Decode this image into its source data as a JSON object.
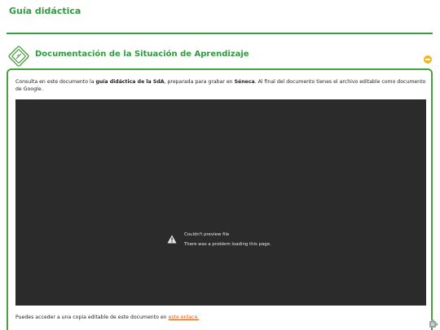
{
  "page": {
    "title": "Guía didáctica"
  },
  "section": {
    "title": "Documentación de la Situación de Aprendizaje"
  },
  "card": {
    "intro": {
      "t1": "Consulta en este documento la ",
      "b1": "guía didáctica de la SdA",
      "t2": ", preparada para grabar en ",
      "b2": "Séneca",
      "t3": ". Al final del documento tienes el archivo editable como documento de Google."
    },
    "preview": {
      "error_title": "Couldn't preview file",
      "error_message": "There was a problem loading this page."
    },
    "footer": {
      "text": "Puedes acceder a una copia editable de este documento en ",
      "link_label": "este enlace.",
      "link_color": "#d45a14"
    }
  },
  "icons": {
    "badge": "document-diamond-icon",
    "toggle": "collapse-minus-icon",
    "warning": "warning-triangle-icon",
    "corner": "puzzle-piece-icon"
  },
  "colors": {
    "accent": "#2e9b3c",
    "border": "#4aa03f",
    "toggle": "#f2b61b",
    "preview_bg": "#2b2b2b"
  }
}
